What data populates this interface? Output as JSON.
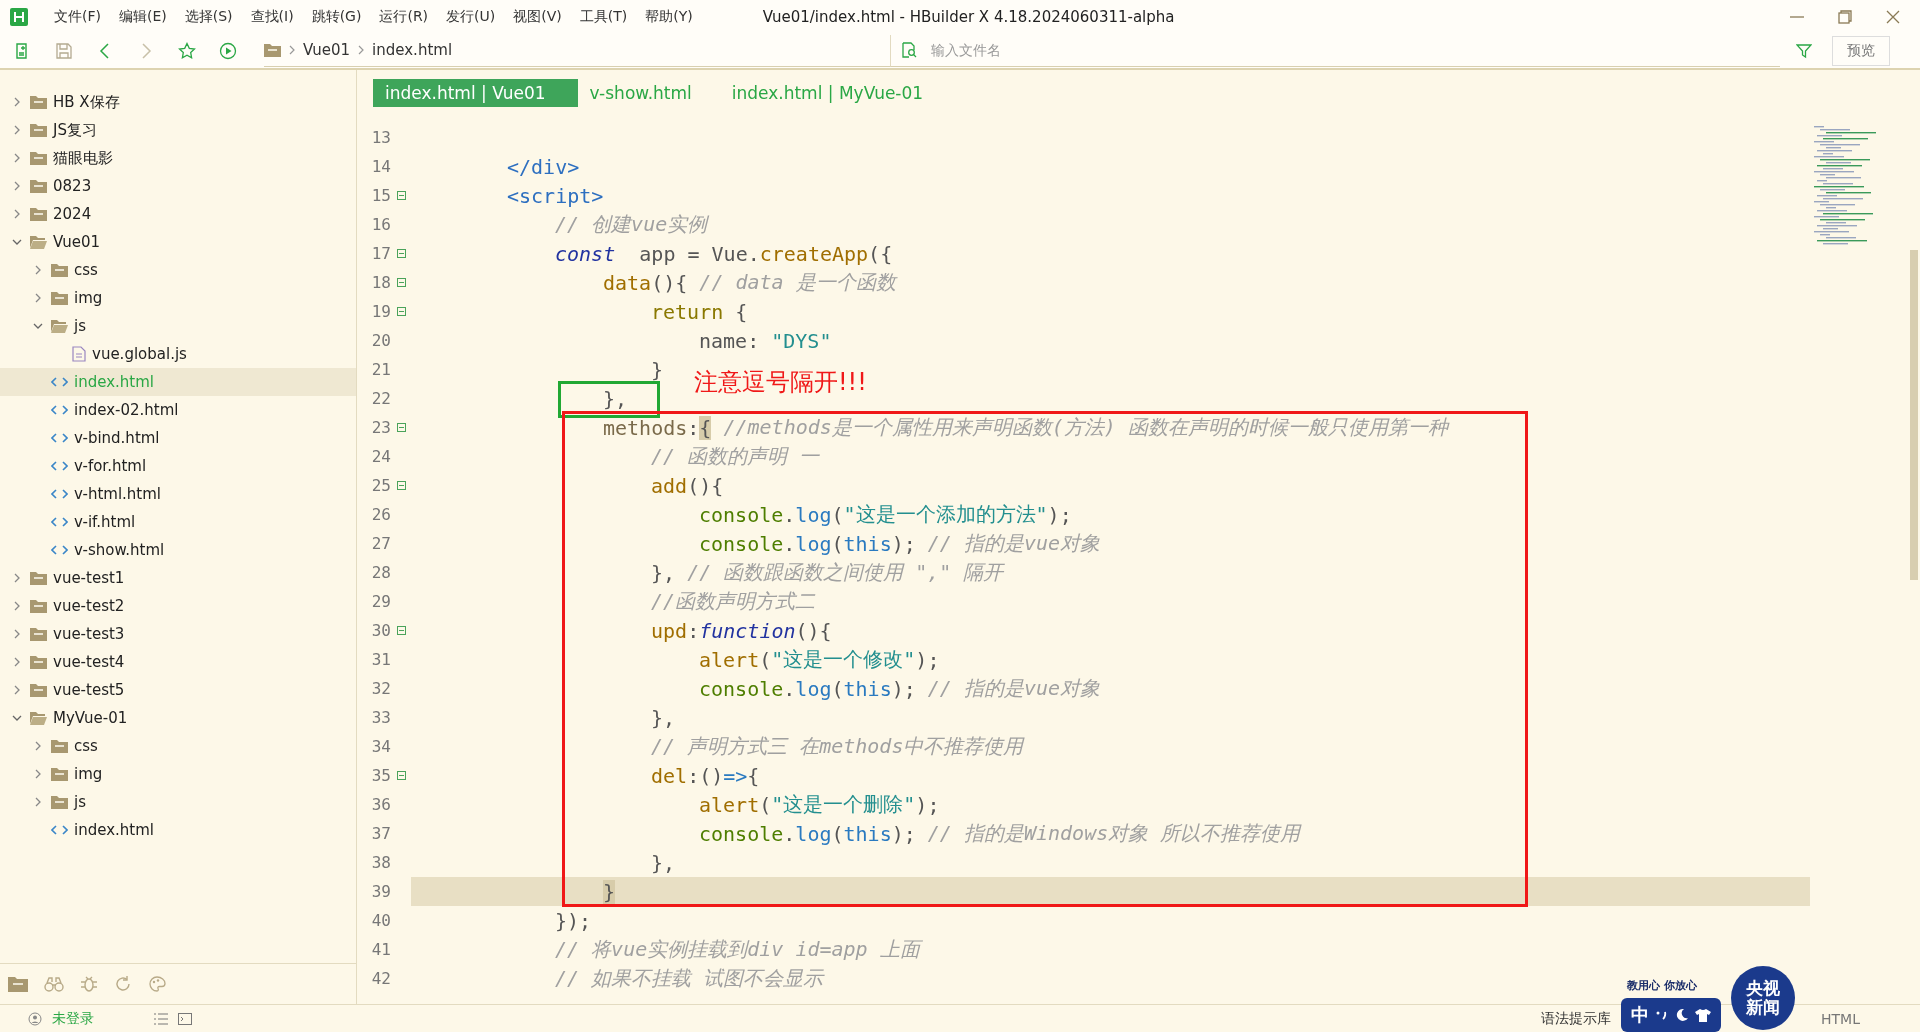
{
  "menu": [
    "文件(F)",
    "编辑(E)",
    "选择(S)",
    "查找(I)",
    "跳转(G)",
    "运行(R)",
    "发行(U)",
    "视图(V)",
    "工具(T)",
    "帮助(Y)"
  ],
  "window": {
    "title": "Vue01/index.html - HBuilder X 4.18.2024060311-alpha"
  },
  "breadcrumb": [
    "Vue01",
    "index.html"
  ],
  "file_search": {
    "placeholder": "输入文件名"
  },
  "preview_button": "预览",
  "tree": [
    {
      "kind": "folder",
      "label": "HB X保存",
      "expanded": false,
      "selected": false
    },
    {
      "kind": "folder",
      "label": "JS复习",
      "expanded": false,
      "selected": false
    },
    {
      "kind": "folder",
      "label": "猫眼电影",
      "expanded": false,
      "selected": false
    },
    {
      "kind": "folder",
      "label": "0823",
      "expanded": false,
      "selected": false
    },
    {
      "kind": "folder",
      "label": "2024",
      "expanded": false,
      "selected": false
    },
    {
      "kind": "folder",
      "label": "Vue01",
      "expanded": true,
      "selected": false,
      "children": [
        {
          "kind": "folder",
          "label": "css",
          "expanded": false,
          "selected": false
        },
        {
          "kind": "folder",
          "label": "img",
          "expanded": false,
          "selected": false
        },
        {
          "kind": "folder",
          "label": "js",
          "expanded": true,
          "selected": false,
          "children": [
            {
              "kind": "js",
              "label": "vue.global.js",
              "selected": false
            }
          ]
        },
        {
          "kind": "html",
          "label": "index.html",
          "selected": true
        },
        {
          "kind": "html",
          "label": "index-02.html",
          "selected": false
        },
        {
          "kind": "html",
          "label": "v-bind.html",
          "selected": false
        },
        {
          "kind": "html",
          "label": "v-for.html",
          "selected": false
        },
        {
          "kind": "html",
          "label": "v-html.html",
          "selected": false
        },
        {
          "kind": "html",
          "label": "v-if.html",
          "selected": false
        },
        {
          "kind": "html",
          "label": "v-show.html",
          "selected": false
        }
      ]
    },
    {
      "kind": "folder",
      "label": "vue-test1",
      "expanded": false,
      "selected": false
    },
    {
      "kind": "folder",
      "label": "vue-test2",
      "expanded": false,
      "selected": false
    },
    {
      "kind": "folder",
      "label": "vue-test3",
      "expanded": false,
      "selected": false
    },
    {
      "kind": "folder",
      "label": "vue-test4",
      "expanded": false,
      "selected": false
    },
    {
      "kind": "folder",
      "label": "vue-test5",
      "expanded": false,
      "selected": false
    },
    {
      "kind": "folder",
      "label": "MyVue-01",
      "expanded": true,
      "selected": false,
      "children": [
        {
          "kind": "folder",
          "label": "css",
          "expanded": false,
          "selected": false
        },
        {
          "kind": "folder",
          "label": "img",
          "expanded": false,
          "selected": false
        },
        {
          "kind": "folder",
          "label": "js",
          "expanded": false,
          "selected": false
        },
        {
          "kind": "html",
          "label": "index.html",
          "selected": false
        }
      ]
    }
  ],
  "tabs": [
    {
      "label": "index.html | Vue01",
      "selected": true
    },
    {
      "label": "v-show.html",
      "selected": false
    },
    {
      "label": "index.html | MyVue-01",
      "selected": false
    }
  ],
  "code_lines": [
    {
      "number": "13",
      "fold": false,
      "current": false
    },
    {
      "number": "14",
      "fold": false,
      "current": false,
      "tokens": [
        {
          "kind": "tag",
          "text": "</div>"
        }
      ]
    },
    {
      "number": "15",
      "fold": true,
      "current": false,
      "tokens": [
        {
          "kind": "tag",
          "text": "<script>"
        }
      ],
      "children": [
        {
          "number": "16",
          "fold": false,
          "current": false,
          "tokens": [
            {
              "kind": "comment",
              "text": "// 创建vue实例"
            }
          ]
        },
        {
          "number": "17",
          "fold": true,
          "current": false,
          "tokens": [
            {
              "kind": "keyword",
              "text": "const"
            },
            {
              "kind": "plain",
              "text": "  app = Vue."
            },
            {
              "kind": "func",
              "text": "createApp"
            },
            {
              "kind": "plain",
              "text": "({"
            }
          ],
          "children": [
            {
              "number": "18",
              "fold": true,
              "current": false,
              "tokens": [
                {
                  "kind": "func",
                  "text": "data"
                },
                {
                  "kind": "plain",
                  "text": "(){ "
                },
                {
                  "kind": "comment",
                  "text": "// data 是一个函数"
                }
              ],
              "children": [
                {
                  "number": "19",
                  "fold": true,
                  "current": false,
                  "tokens": [
                    {
                      "kind": "control",
                      "text": "return"
                    },
                    {
                      "kind": "plain",
                      "text": " {"
                    }
                  ],
                  "children": [
                    {
                      "number": "20",
                      "fold": false,
                      "current": false,
                      "tokens": [
                        {
                          "kind": "plain",
                          "text": "name: "
                        },
                        {
                          "kind": "string",
                          "text": "\"DYS\""
                        }
                      ]
                    }
                  ]
                },
                {
                  "number": "21",
                  "fold": false,
                  "current": false,
                  "tokens": [
                    {
                      "kind": "plain",
                      "text": "}"
                    }
                  ]
                }
              ]
            },
            {
              "number": "22",
              "fold": false,
              "current": false,
              "tokens": [
                {
                  "kind": "plain",
                  "text": "},"
                }
              ]
            },
            {
              "number": "23",
              "fold": true,
              "current": false,
              "tokens": [
                {
                  "kind": "property",
                  "text": "methods"
                },
                {
                  "kind": "plain",
                  "text": ":"
                },
                {
                  "kind": "match",
                  "text": "{"
                },
                {
                  "kind": "comment",
                  "text": " //methods是一个属性用来声明函数(方法) 函数在声明的时候一般只使用第一种"
                }
              ],
              "children": [
                {
                  "number": "24",
                  "fold": false,
                  "current": false,
                  "tokens": [
                    {
                      "kind": "comment",
                      "text": "// 函数的声明 一"
                    }
                  ]
                },
                {
                  "number": "25",
                  "fold": true,
                  "current": false,
                  "tokens": [
                    {
                      "kind": "func",
                      "text": "add"
                    },
                    {
                      "kind": "plain",
                      "text": "(){"
                    }
                  ],
                  "children": [
                    {
                      "number": "26",
                      "fold": false,
                      "current": false,
                      "tokens": [
                        {
                          "kind": "object",
                          "text": "console"
                        },
                        {
                          "kind": "plain",
                          "text": "."
                        },
                        {
                          "kind": "call",
                          "text": "log"
                        },
                        {
                          "kind": "plain",
                          "text": "("
                        },
                        {
                          "kind": "string",
                          "text": "\"这是一个添加的方法\""
                        },
                        {
                          "kind": "plain",
                          "text": ");"
                        }
                      ]
                    },
                    {
                      "number": "27",
                      "fold": false,
                      "current": false,
                      "tokens": [
                        {
                          "kind": "object",
                          "text": "console"
                        },
                        {
                          "kind": "plain",
                          "text": "."
                        },
                        {
                          "kind": "call",
                          "text": "log"
                        },
                        {
                          "kind": "plain",
                          "text": "("
                        },
                        {
                          "kind": "call",
                          "text": "this"
                        },
                        {
                          "kind": "plain",
                          "text": "); "
                        },
                        {
                          "kind": "comment",
                          "text": "// 指的是vue对象"
                        }
                      ]
                    }
                  ]
                },
                {
                  "number": "28",
                  "fold": false,
                  "current": false,
                  "tokens": [
                    {
                      "kind": "plain",
                      "text": "}, "
                    },
                    {
                      "kind": "comment",
                      "text": "// 函数跟函数之间使用 \",\" 隔开"
                    }
                  ]
                },
                {
                  "number": "29",
                  "fold": false,
                  "current": false,
                  "tokens": [
                    {
                      "kind": "comment",
                      "text": "//函数声明方式二"
                    }
                  ]
                },
                {
                  "number": "30",
                  "fold": true,
                  "current": false,
                  "tokens": [
                    {
                      "kind": "func",
                      "text": "upd"
                    },
                    {
                      "kind": "plain",
                      "text": ":"
                    },
                    {
                      "kind": "keyword",
                      "text": "function"
                    },
                    {
                      "kind": "plain",
                      "text": "(){"
                    }
                  ],
                  "children": [
                    {
                      "number": "31",
                      "fold": false,
                      "current": false,
                      "tokens": [
                        {
                          "kind": "func",
                          "text": "alert"
                        },
                        {
                          "kind": "plain",
                          "text": "("
                        },
                        {
                          "kind": "string",
                          "text": "\"这是一个修改\""
                        },
                        {
                          "kind": "plain",
                          "text": ");"
                        }
                      ]
                    },
                    {
                      "number": "32",
                      "fold": false,
                      "current": false,
                      "tokens": [
                        {
                          "kind": "object",
                          "text": "console"
                        },
                        {
                          "kind": "plain",
                          "text": "."
                        },
                        {
                          "kind": "call",
                          "text": "log"
                        },
                        {
                          "kind": "plain",
                          "text": "("
                        },
                        {
                          "kind": "call",
                          "text": "this"
                        },
                        {
                          "kind": "plain",
                          "text": "); "
                        },
                        {
                          "kind": "comment",
                          "text": "// 指的是vue对象"
                        }
                      ]
                    }
                  ]
                },
                {
                  "number": "33",
                  "fold": false,
                  "current": false,
                  "tokens": [
                    {
                      "kind": "plain",
                      "text": "},"
                    }
                  ]
                },
                {
                  "number": "34",
                  "fold": false,
                  "current": false,
                  "tokens": [
                    {
                      "kind": "comment",
                      "text": "// 声明方式三 在methods中不推荐使用"
                    }
                  ]
                },
                {
                  "number": "35",
                  "fold": true,
                  "current": false,
                  "tokens": [
                    {
                      "kind": "func",
                      "text": "del"
                    },
                    {
                      "kind": "plain",
                      "text": ":()"
                    },
                    {
                      "kind": "call",
                      "text": "=>"
                    },
                    {
                      "kind": "plain",
                      "text": "{"
                    }
                  ],
                  "children": [
                    {
                      "number": "36",
                      "fold": false,
                      "current": false,
                      "tokens": [
                        {
                          "kind": "func",
                          "text": "alert"
                        },
                        {
                          "kind": "plain",
                          "text": "("
                        },
                        {
                          "kind": "string",
                          "text": "\"这是一个删除\""
                        },
                        {
                          "kind": "plain",
                          "text": ");"
                        }
                      ]
                    },
                    {
                      "number": "37",
                      "fold": false,
                      "current": false,
                      "tokens": [
                        {
                          "kind": "object",
                          "text": "console"
                        },
                        {
                          "kind": "plain",
                          "text": "."
                        },
                        {
                          "kind": "call",
                          "text": "log"
                        },
                        {
                          "kind": "plain",
                          "text": "("
                        },
                        {
                          "kind": "call",
                          "text": "this"
                        },
                        {
                          "kind": "plain",
                          "text": "); "
                        },
                        {
                          "kind": "comment",
                          "text": "// 指的是Windows对象 所以不推荐使用"
                        }
                      ]
                    }
                  ]
                },
                {
                  "number": "38",
                  "fold": false,
                  "current": false,
                  "tokens": [
                    {
                      "kind": "plain",
                      "text": "},"
                    }
                  ]
                }
              ]
            },
            {
              "number": "39",
              "fold": false,
              "current": true,
              "tokens": [
                {
                  "kind": "match",
                  "text": "}"
                }
              ]
            }
          ]
        },
        {
          "number": "40",
          "fold": false,
          "current": false,
          "tokens": [
            {
              "kind": "plain",
              "text": "});"
            }
          ]
        },
        {
          "number": "41",
          "fold": false,
          "current": false,
          "tokens": [
            {
              "kind": "comment",
              "text": "// 将vue实例挂载到div id=app 上面"
            }
          ]
        },
        {
          "number": "42",
          "fold": false,
          "current": false,
          "tokens": [
            {
              "kind": "comment",
              "text": "// 如果不挂载 试图不会显示"
            }
          ]
        }
      ]
    }
  ],
  "annotation": {
    "note": "注意逗号隔开!!!"
  },
  "status_bar": {
    "login": "未登录",
    "syntax_library": "语法提示库",
    "file_type": "HTML"
  },
  "ime_toolbar": {
    "slogan": "教用心 你放心",
    "mode": "中",
    "badge_top": "央视",
    "badge_bottom": "新闻"
  }
}
